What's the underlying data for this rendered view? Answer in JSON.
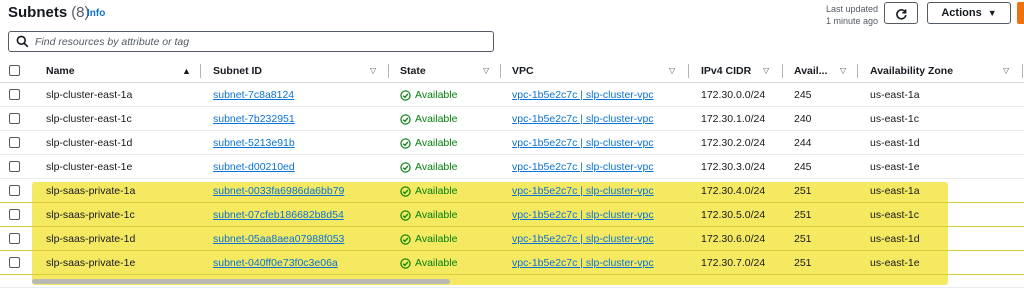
{
  "header": {
    "title": "Subnets",
    "count": "(8)",
    "info": "Info",
    "last_updated_line1": "Last updated",
    "last_updated_line2": "1 minute ago",
    "actions_label": "Actions"
  },
  "search": {
    "placeholder": "Find resources by attribute or tag"
  },
  "columns": [
    "Name",
    "Subnet ID",
    "State",
    "VPC",
    "IPv4 CIDR",
    "Avail...",
    "Availability Zone"
  ],
  "rows": [
    {
      "name": "slp-cluster-east-1a",
      "subnet_id": "subnet-7c8a8124",
      "state": "Available",
      "vpc": "vpc-1b5e2c7c | slp-cluster-vpc",
      "cidr": "172.30.0.0/24",
      "avail": "245",
      "az": "us-east-1a"
    },
    {
      "name": "slp-cluster-east-1c",
      "subnet_id": "subnet-7b232951",
      "state": "Available",
      "vpc": "vpc-1b5e2c7c | slp-cluster-vpc",
      "cidr": "172.30.1.0/24",
      "avail": "240",
      "az": "us-east-1c"
    },
    {
      "name": "slp-cluster-east-1d",
      "subnet_id": "subnet-5213e91b",
      "state": "Available",
      "vpc": "vpc-1b5e2c7c | slp-cluster-vpc",
      "cidr": "172.30.2.0/24",
      "avail": "244",
      "az": "us-east-1d"
    },
    {
      "name": "slp-cluster-east-1e",
      "subnet_id": "subnet-d00210ed",
      "state": "Available",
      "vpc": "vpc-1b5e2c7c | slp-cluster-vpc",
      "cidr": "172.30.3.0/24",
      "avail": "245",
      "az": "us-east-1e"
    },
    {
      "name": "slp-saas-private-1a",
      "subnet_id": "subnet-0033fa6986da6bb79",
      "state": "Available",
      "vpc": "vpc-1b5e2c7c | slp-cluster-vpc",
      "cidr": "172.30.4.0/24",
      "avail": "251",
      "az": "us-east-1a"
    },
    {
      "name": "slp-saas-private-1c",
      "subnet_id": "subnet-07cfeb186682b8d54",
      "state": "Available",
      "vpc": "vpc-1b5e2c7c | slp-cluster-vpc",
      "cidr": "172.30.5.0/24",
      "avail": "251",
      "az": "us-east-1c"
    },
    {
      "name": "slp-saas-private-1d",
      "subnet_id": "subnet-05aa8aea07988f053",
      "state": "Available",
      "vpc": "vpc-1b5e2c7c | slp-cluster-vpc",
      "cidr": "172.30.6.0/24",
      "avail": "251",
      "az": "us-east-1d"
    },
    {
      "name": "slp-saas-private-1e",
      "subnet_id": "subnet-040ff0e73f0c3e06a",
      "state": "Available",
      "vpc": "vpc-1b5e2c7c | slp-cluster-vpc",
      "cidr": "172.30.7.0/24",
      "avail": "251",
      "az": "us-east-1e"
    }
  ],
  "colors": {
    "link": "#0972d3",
    "available": "#037f0c",
    "highlight": "#f2e64a",
    "accent": "#ec7211"
  },
  "icons": {
    "search": "search-icon",
    "refresh": "refresh-icon",
    "actions_caret": "caret-down-icon",
    "state": "check-circle-icon",
    "sort_asc": "sort-ascending-icon",
    "sort": "sort-icon"
  }
}
